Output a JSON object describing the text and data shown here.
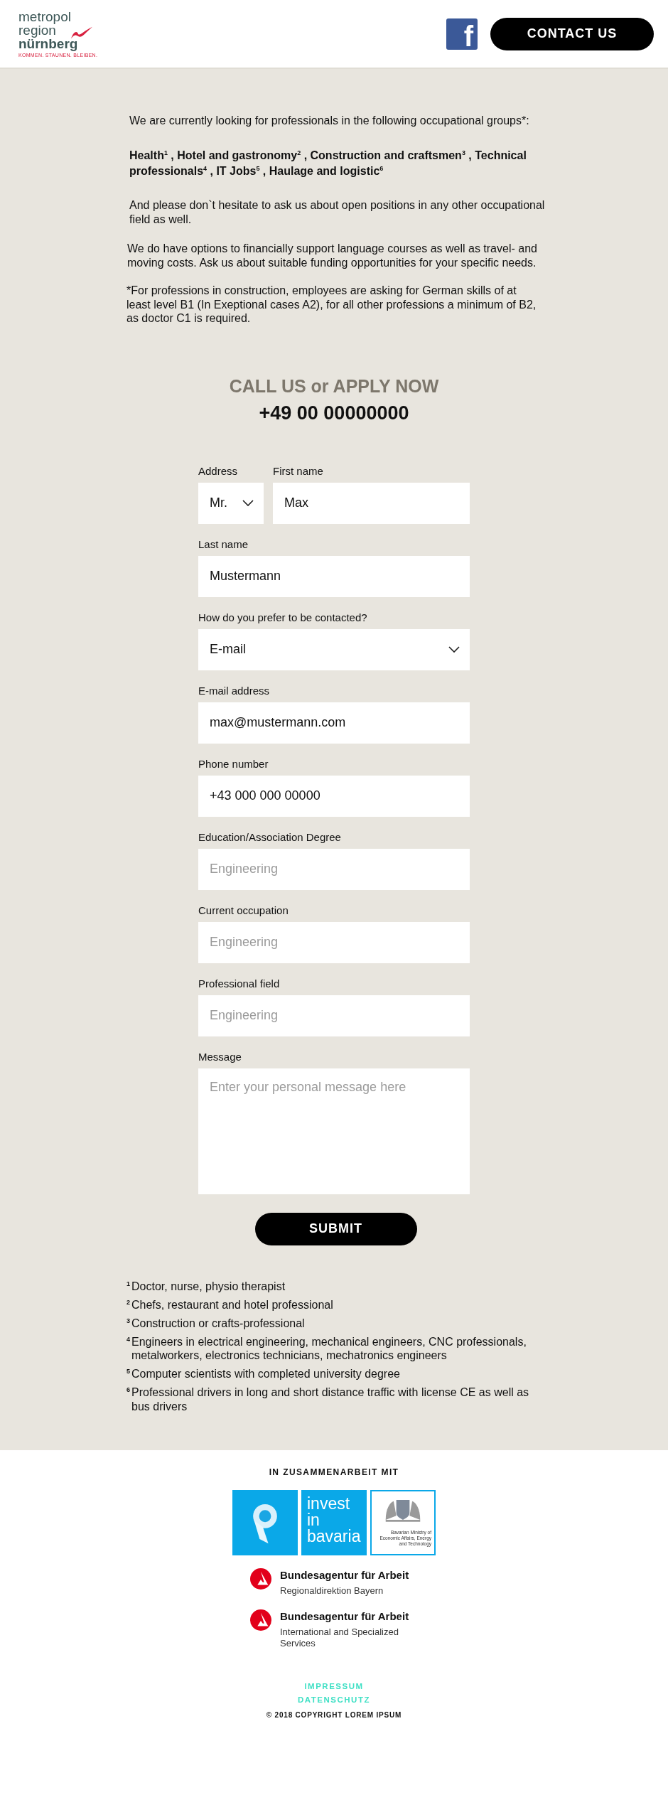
{
  "header": {
    "logo": {
      "lines": [
        "metropol",
        "region",
        "nürnberg"
      ],
      "tagline": "KOMMEN. STAUNEN. BLEIBEN."
    },
    "facebook": "f",
    "contact_button": "CONTACT US"
  },
  "intro": {
    "lead": "We are currently looking for professionals in the following occupational groups*:",
    "groups": "Health$^{1}$ , Hotel and gastronomy$^{2}$ , Construction and craftsmen$^{3}$ , Technical professionals$^{4}$ , IT Jobs$^{5}$ , Haulage and logistic$^{6}$",
    "paragraphs": [
      "And please don`t hesitate to ask us about open positions in any other occupational field as well.",
      "We do have options to financially support language courses as well as travel- and moving costs. Ask us about suitable funding opportunities for your specific needs."
    ],
    "note": "*For professions in construction, employees are asking for German skills of at least level B1 (In Exeptional cases A2), for all other professions a minimum of B2, as doctor C1 is required."
  },
  "call": {
    "heading": "CALL US or APPLY NOW",
    "phone": "+49 00 00000000"
  },
  "form": {
    "rows": [
      [
        {
          "kind": "select",
          "label": "Address",
          "value": "Mr."
        },
        {
          "kind": "text",
          "label": "First name",
          "value": "Max"
        }
      ],
      [
        {
          "kind": "text",
          "label": "Last name",
          "value": "Mustermann"
        }
      ],
      [
        {
          "kind": "select",
          "label": "How do you prefer to be contacted?",
          "value": "E-mail"
        }
      ],
      [
        {
          "kind": "text",
          "label": "E-mail address",
          "value": "max@mustermann.com"
        }
      ],
      [
        {
          "kind": "text",
          "label": "Phone number",
          "value": "+43 000 000 00000"
        }
      ],
      [
        {
          "kind": "text",
          "label": "Education/Association Degree",
          "placeholder": "Engineering"
        }
      ],
      [
        {
          "kind": "text",
          "label": "Current occupation",
          "placeholder": "Engineering"
        }
      ],
      [
        {
          "kind": "text",
          "label": "Professional field",
          "placeholder": "Engineering"
        }
      ],
      [
        {
          "kind": "textarea",
          "label": "Message",
          "placeholder": "Enter your personal message here"
        }
      ]
    ],
    "submit": "SUBMIT"
  },
  "footnotes": [
    {
      "mark": "1",
      "text": "Doctor, nurse, physio therapist"
    },
    {
      "mark": "2",
      "text": "Chefs, restaurant and hotel professional"
    },
    {
      "mark": "3",
      "text": "Construction or crafts-professional"
    },
    {
      "mark": "4",
      "text": "Engineers in electrical engineering, mechanical engineers, CNC professionals, metalworkers, electronics technicians, mechatronics engineers"
    },
    {
      "mark": "5",
      "text": "Computer scientists with completed university degree"
    },
    {
      "mark": "6",
      "text": "Professional drivers in long and short distance traffic with license CE as well as bus drivers"
    }
  ],
  "footer": {
    "heading": "IN ZUSAMMENARBEIT MIT",
    "invest_logo": [
      "invest",
      "in",
      "bavaria"
    ],
    "ministry": "Bavarian Ministry of Economic Affairs, Energy and Technology",
    "agencies": [
      {
        "name": "Bundesagentur für Arbeit",
        "unit": "Regionaldirektion Bayern"
      },
      {
        "name": "Bundesagentur für Arbeit",
        "unit": "International and Specialized Services"
      }
    ],
    "links": [
      "IMPRESSUM",
      "DATENSCHUTZ"
    ],
    "copyright": "© 2018 COPYRIGHT LOREM IPSUM"
  }
}
